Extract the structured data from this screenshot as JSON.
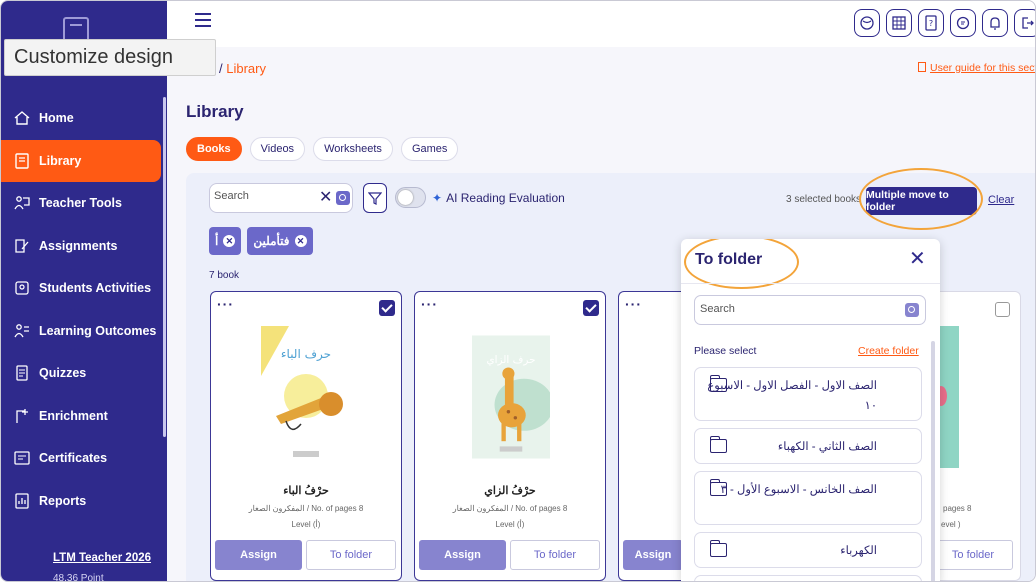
{
  "tooltip": "Customize design",
  "sidebar": {
    "items": [
      {
        "label": "Home",
        "icon": "home-icon"
      },
      {
        "label": "Library",
        "icon": "library-icon",
        "active": true
      },
      {
        "label": "Teacher Tools",
        "icon": "teacher-tools-icon"
      },
      {
        "label": "Assignments",
        "icon": "assignments-icon"
      },
      {
        "label": "Students Activities",
        "icon": "students-activities-icon"
      },
      {
        "label": "Learning Outcomes",
        "icon": "learning-outcomes-icon"
      },
      {
        "label": "Quizzes",
        "icon": "quizzes-icon"
      },
      {
        "label": "Enrichment",
        "icon": "enrichment-icon"
      },
      {
        "label": "Certificates",
        "icon": "certificates-icon"
      },
      {
        "label": "Reports",
        "icon": "reports-icon"
      }
    ],
    "user": "LTM Teacher 2026",
    "points": "48.36 Point"
  },
  "breadcrumb": {
    "prefix": "e",
    "current": "Library"
  },
  "guide_link": "User guide for this section",
  "page_title": "Library",
  "tabs": [
    "Books",
    "Videos",
    "Worksheets",
    "Games"
  ],
  "toolbar": {
    "search_placeholder": "Search",
    "ai_label": "AI Reading Evaluation",
    "selected_count": "3 selected books",
    "move_button": "Multiple move to folder",
    "clear": "Clear"
  },
  "chips": [
    "أ",
    "فتأملين"
  ],
  "book_count": "7 book",
  "books": [
    {
      "title": "حرْفُ الباء",
      "cover_text": "حرف الباء",
      "meta": "المفكرون الصغار / No. of pages 8",
      "level": "Level (أ)",
      "assign": "Assign",
      "to_folder": "To folder",
      "checked": true
    },
    {
      "title": "حرْفُ الزاي",
      "cover_text": "حرف الزاي",
      "meta": "المفكرون الصغار / No. of pages 8",
      "level": "Level (أ)",
      "assign": "Assign",
      "to_folder": "To folder",
      "checked": true
    },
    {
      "title": "",
      "cover_text": "",
      "meta": "",
      "level": "",
      "assign": "Assign",
      "to_folder": "",
      "checked": true
    },
    {
      "title": "",
      "cover_text": "",
      "meta": "pages 8",
      "level": "evel )",
      "assign": "",
      "to_folder": "To folder",
      "checked": false
    }
  ],
  "modal": {
    "title": "To folder",
    "search_placeholder": "Search",
    "please_select": "Please select",
    "create_folder": "Create folder",
    "folders": [
      "الصف الاول - الفصل الاول - الاسبوع ١٠",
      "الصف الثاني - الكهباء",
      "الصف الخانس - الاسبوع الأول - ٣",
      "الكهرباء"
    ]
  },
  "colors": {
    "sidebar": "#2f2a8c",
    "accent": "#ff5a14",
    "highlight_ring": "#f3a43a"
  }
}
